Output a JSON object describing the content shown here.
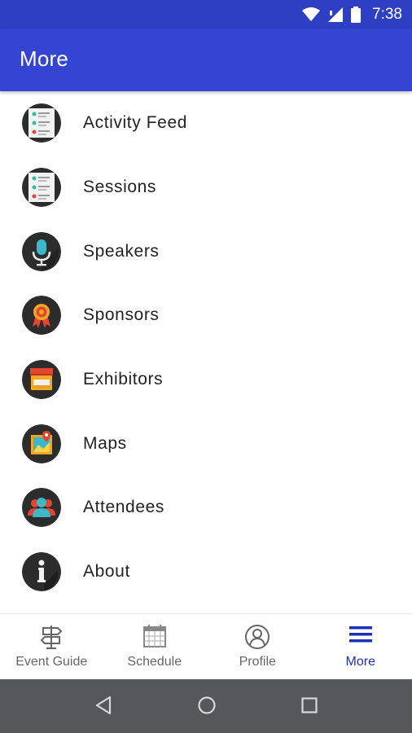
{
  "status_bar": {
    "time": "7:38"
  },
  "app_bar": {
    "title": "More"
  },
  "menu": {
    "items": [
      {
        "label": "Activity Feed",
        "icon": "activity-feed-icon"
      },
      {
        "label": "Sessions",
        "icon": "sessions-icon"
      },
      {
        "label": "Speakers",
        "icon": "microphone-icon"
      },
      {
        "label": "Sponsors",
        "icon": "ribbon-award-icon"
      },
      {
        "label": "Exhibitors",
        "icon": "booth-icon"
      },
      {
        "label": "Maps",
        "icon": "map-pin-icon"
      },
      {
        "label": "Attendees",
        "icon": "people-icon"
      },
      {
        "label": "About",
        "icon": "info-icon"
      }
    ]
  },
  "bottom_nav": {
    "items": [
      {
        "label": "Event Guide",
        "icon": "signpost-icon",
        "active": false
      },
      {
        "label": "Schedule",
        "icon": "calendar-icon",
        "active": false
      },
      {
        "label": "Profile",
        "icon": "profile-icon",
        "active": false
      },
      {
        "label": "More",
        "icon": "hamburger-menu-icon",
        "active": true
      }
    ]
  },
  "colors": {
    "status_bar": "#2f3fc4",
    "app_bar": "#3445d2",
    "active_nav": "#1f2fb8",
    "system_nav": "#54585b"
  }
}
